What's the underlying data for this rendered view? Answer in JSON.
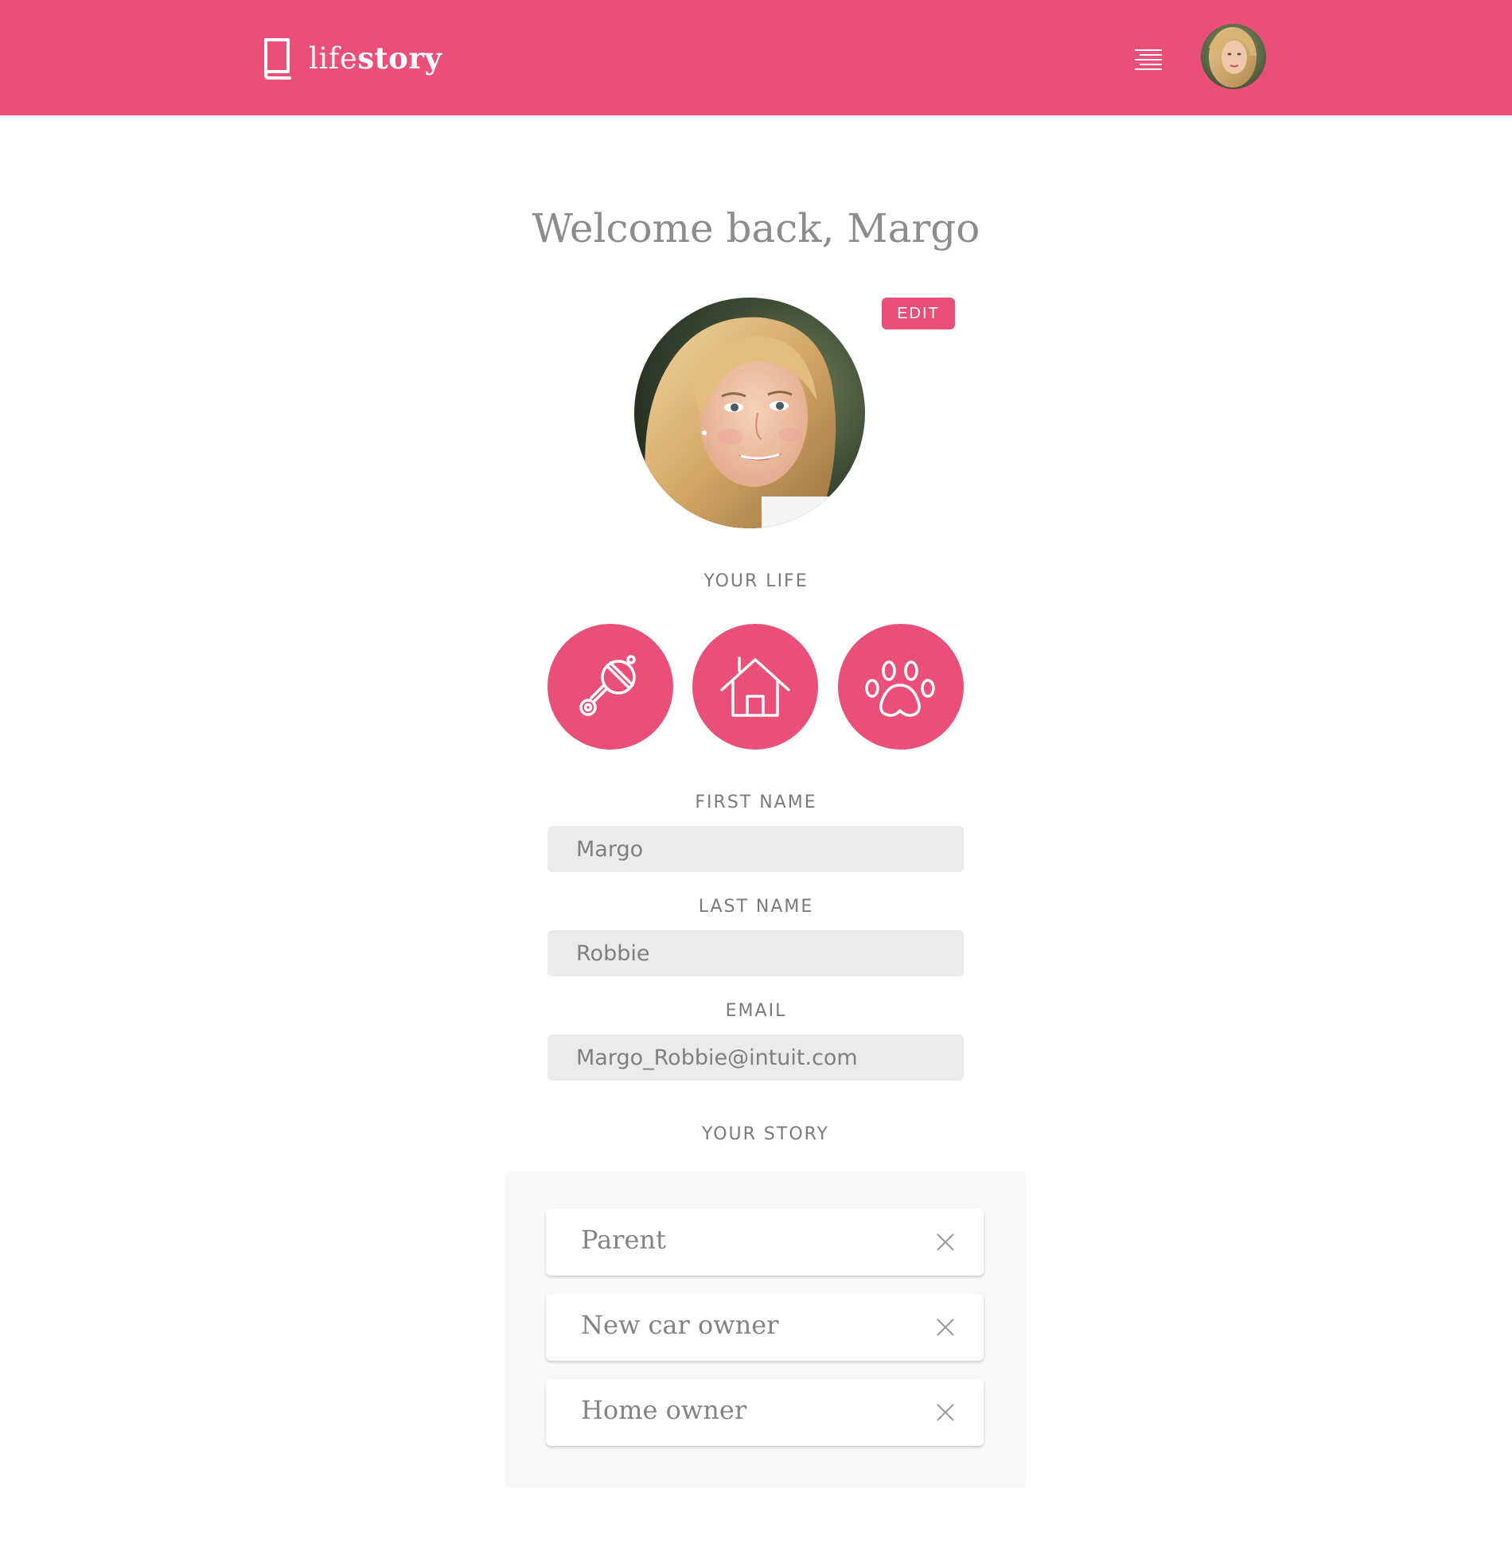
{
  "brand": {
    "name_light": "life",
    "name_bold": "story",
    "color": "#ea5077"
  },
  "header": {
    "menu_icon": "menu-lines-icon",
    "avatar_icon": "user-avatar"
  },
  "welcome": {
    "title": "Welcome back, Margo"
  },
  "profile": {
    "edit_label": "EDIT"
  },
  "your_life": {
    "label": "YOUR LIFE",
    "icons": [
      "baby-rattle-icon",
      "house-icon",
      "paw-icon"
    ]
  },
  "form": {
    "first_name": {
      "label": "FIRST NAME",
      "value": "Margo"
    },
    "last_name": {
      "label": "LAST NAME",
      "value": "Robbie"
    },
    "email": {
      "label": "EMAIL",
      "value": "Margo_Robbie@intuit.com"
    }
  },
  "your_story": {
    "label": "YOUR STORY",
    "items": [
      {
        "label": "Parent"
      },
      {
        "label": "New car owner"
      },
      {
        "label": "Home owner"
      }
    ]
  }
}
